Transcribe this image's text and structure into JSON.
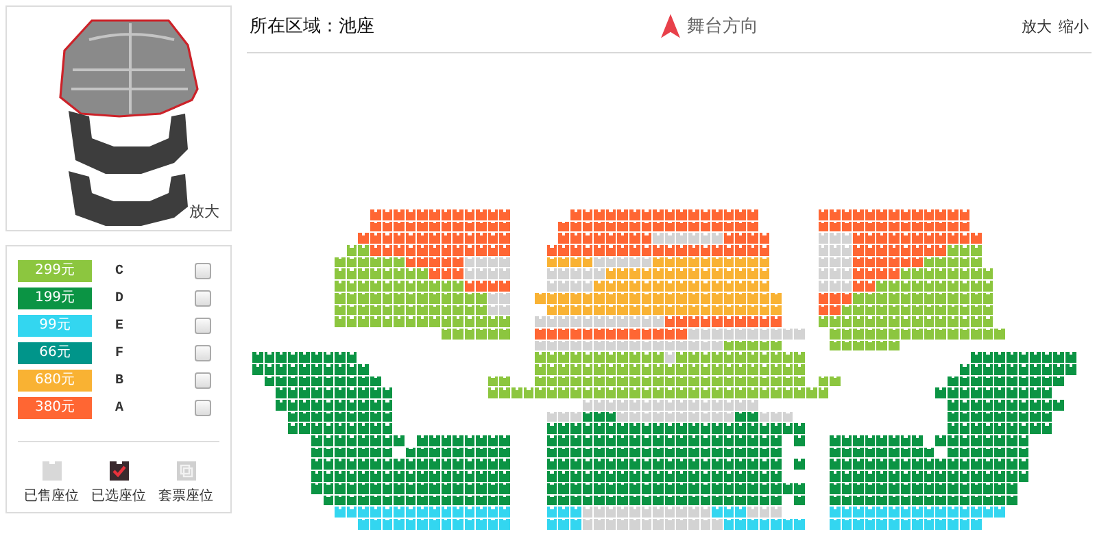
{
  "thumbnail": {
    "zoom_label": "放大"
  },
  "legend": [
    {
      "price": "299元",
      "tier": "C",
      "color": "#8cc63f",
      "checked": false
    },
    {
      "price": "199元",
      "tier": "D",
      "color": "#0b9444",
      "checked": false
    },
    {
      "price": "99元",
      "tier": "E",
      "color": "#33d6f0",
      "checked": false
    },
    {
      "price": "66元",
      "tier": "F",
      "color": "#00958a",
      "checked": false
    },
    {
      "price": "680元",
      "tier": "B",
      "color": "#f9b233",
      "checked": false
    },
    {
      "price": "380元",
      "tier": "A",
      "color": "#ff6633",
      "checked": false
    }
  ],
  "status_legend": [
    {
      "label": "已售座位",
      "kind": "sold"
    },
    {
      "label": "已选座位",
      "kind": "selected"
    },
    {
      "label": "套票座位",
      "kind": "package"
    }
  ],
  "header": {
    "area": "所在区域：池座",
    "stage": "舞台方向",
    "zoom_in": "放大",
    "zoom_out": "缩小"
  }
}
